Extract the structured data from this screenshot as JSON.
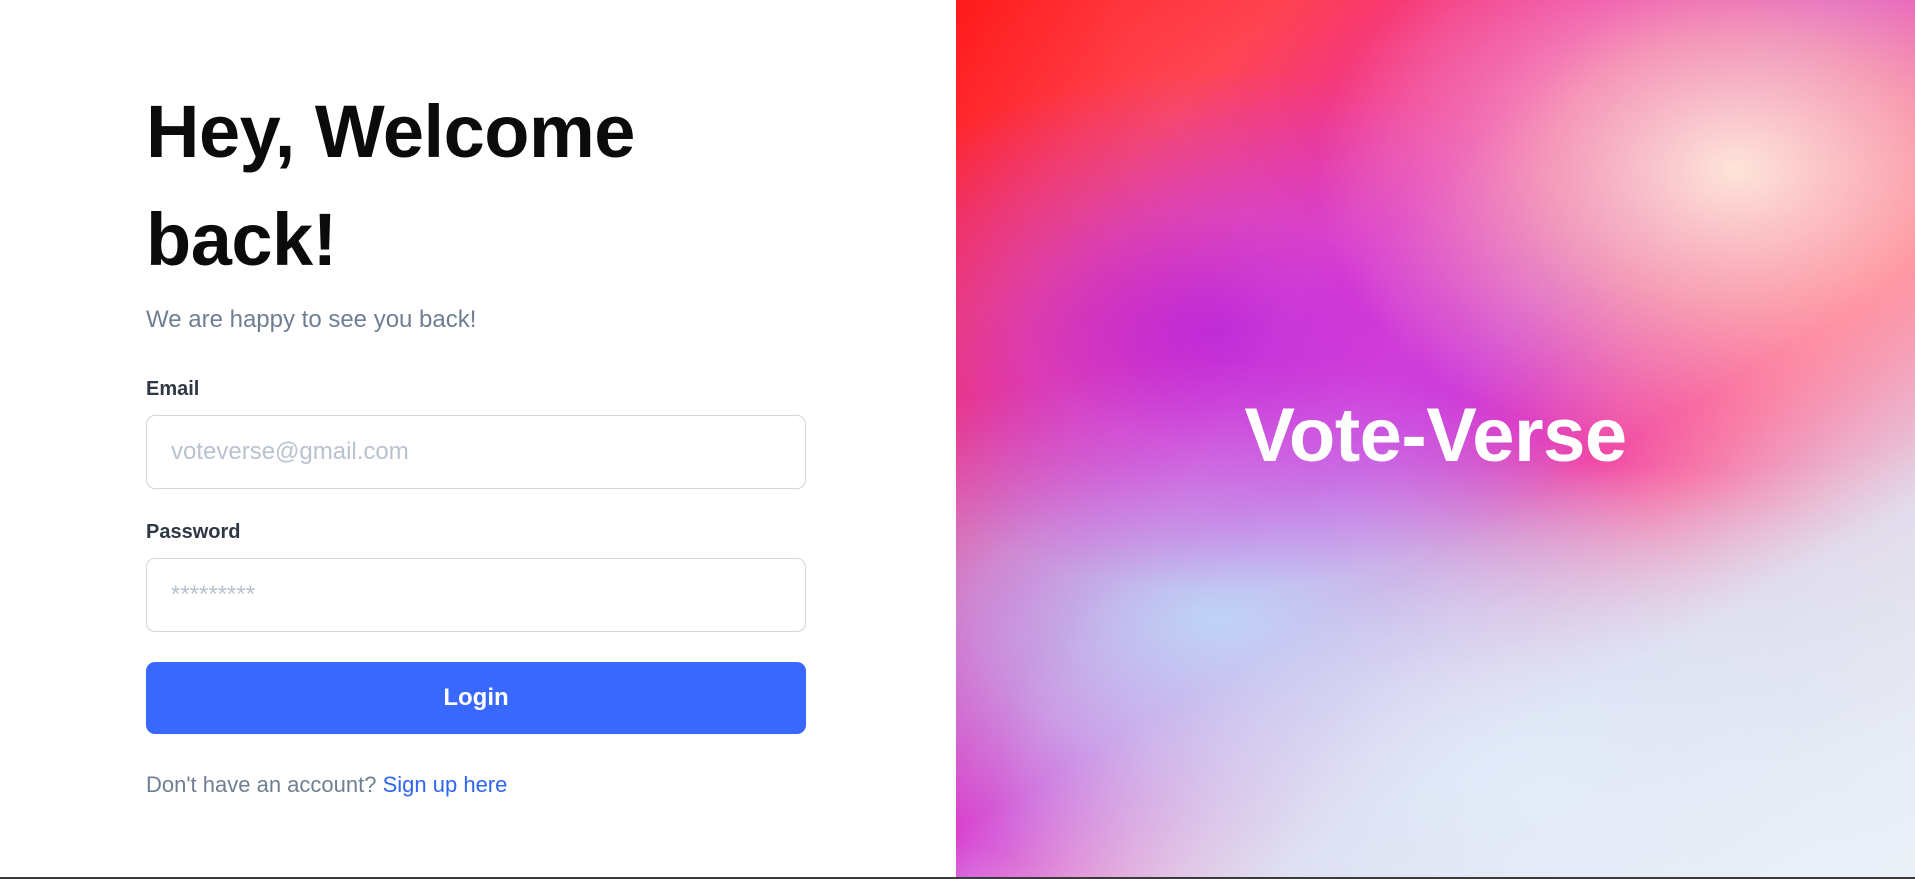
{
  "login": {
    "heading": "Hey, Welcome back!",
    "subtitle": "We are happy to see you back!",
    "email_label": "Email",
    "email_placeholder": "voteverse@gmail.com",
    "password_label": "Password",
    "password_placeholder": "*********",
    "login_button": "Login",
    "signup_prompt": "Don't have an account?",
    "signup_link": "Sign up here"
  },
  "hero": {
    "brand": "Vote-Verse"
  },
  "colors": {
    "accent": "#3968ff",
    "link": "#2f66f0",
    "muted_text": "#6f7f93"
  }
}
